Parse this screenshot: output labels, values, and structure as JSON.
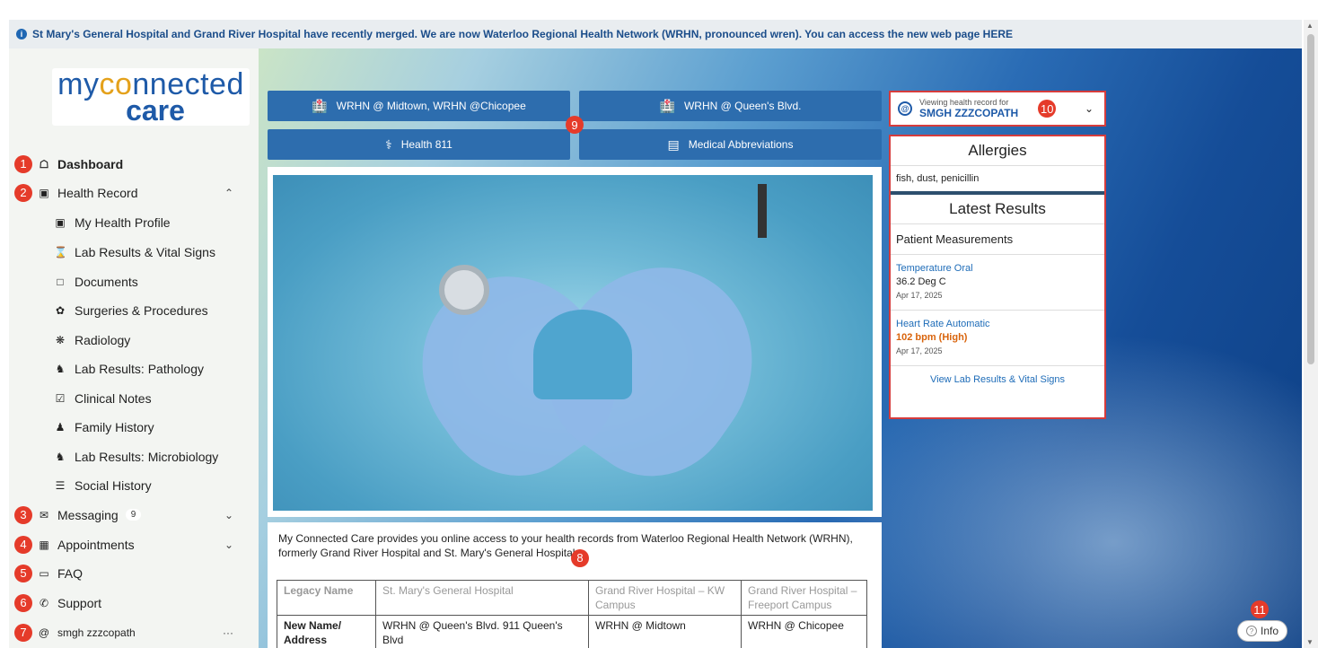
{
  "banner": {
    "text": "St Mary's General Hospital and Grand River Hospital have recently merged.  We are now Waterloo Regional Health Network (WRHN, pronounced wren).  You can access the new web page HERE"
  },
  "logo": {
    "line1_a": "my",
    "line1_o": "c",
    "line1_o2": "o",
    "line1_b": "nnected",
    "line2": "care"
  },
  "sidebar": {
    "items": [
      {
        "label": "Dashboard",
        "icon": "home-icon",
        "marker": "1"
      },
      {
        "label": "Health Record",
        "icon": "health-record-icon",
        "marker": "2"
      },
      {
        "label": "My Health Profile",
        "icon": "profile-icon"
      },
      {
        "label": "Lab Results & Vital Signs",
        "icon": "hourglass-icon"
      },
      {
        "label": "Documents",
        "icon": "document-icon"
      },
      {
        "label": "Surgeries & Procedures",
        "icon": "bandage-icon"
      },
      {
        "label": "Radiology",
        "icon": "radiology-icon"
      },
      {
        "label": "Lab Results: Pathology",
        "icon": "microscope-icon"
      },
      {
        "label": "Clinical Notes",
        "icon": "clipboard-icon"
      },
      {
        "label": "Family History",
        "icon": "family-icon"
      },
      {
        "label": "Lab Results: Microbiology",
        "icon": "microscope-icon"
      },
      {
        "label": "Social History",
        "icon": "social-icon"
      },
      {
        "label": "Messaging",
        "icon": "envelope-icon",
        "marker": "3",
        "badge": "9"
      },
      {
        "label": "Appointments",
        "icon": "calendar-icon",
        "marker": "4"
      },
      {
        "label": "FAQ",
        "icon": "monitor-icon",
        "marker": "5"
      },
      {
        "label": "Support",
        "icon": "phone-icon",
        "marker": "6"
      },
      {
        "label": "smgh zzzcopath",
        "icon": "at-icon",
        "marker": "7",
        "more": "···"
      }
    ]
  },
  "top_buttons": {
    "b1": "WRHN @ Midtown, WRHN @Chicopee",
    "b2": "WRHN @ Queen's Blvd.",
    "b3": "Health 811",
    "b4": "Medical Abbreviations",
    "marker": "9"
  },
  "viewing": {
    "caption": "Viewing health record for",
    "name": "SMGH ZZZCOPATH",
    "marker": "10"
  },
  "allergies": {
    "title": "Allergies",
    "text": "fish,   dust,   penicillin"
  },
  "latest": {
    "title": "Latest Results",
    "section": "Patient Measurements",
    "r1_name": "Temperature Oral",
    "r1_value": "36.2 Deg C",
    "r1_date": "Apr 17, 2025",
    "r2_name": "Heart Rate Automatic",
    "r2_value": "102 bpm (High)",
    "r2_date": "Apr 17, 2025",
    "link": "View Lab Results & Vital Signs"
  },
  "info": {
    "paragraph": "My Connected Care provides you online access to your health records from Waterloo Regional Health Network (WRHN), formerly Grand River Hospital and St. Mary's General Hospital.",
    "marker": "8",
    "table": {
      "row1": [
        "Legacy Name",
        "St. Mary's General Hospital",
        "Grand River Hospital – KW Campus",
        "Grand River Hospital – Freeport Campus"
      ],
      "row2": [
        "New Name/ Address",
        "WRHN @ Queen's Blvd. 911 Queen's Blvd",
        "WRHN @ Midtown",
        "WRHN @ Chicopee"
      ]
    }
  },
  "info_button": {
    "label": "Info",
    "marker": "11"
  },
  "colors": {
    "accent": "#2d6dae",
    "marker": "#e53b2a",
    "highlight_border": "#d63c3c",
    "high": "#d9640c"
  }
}
